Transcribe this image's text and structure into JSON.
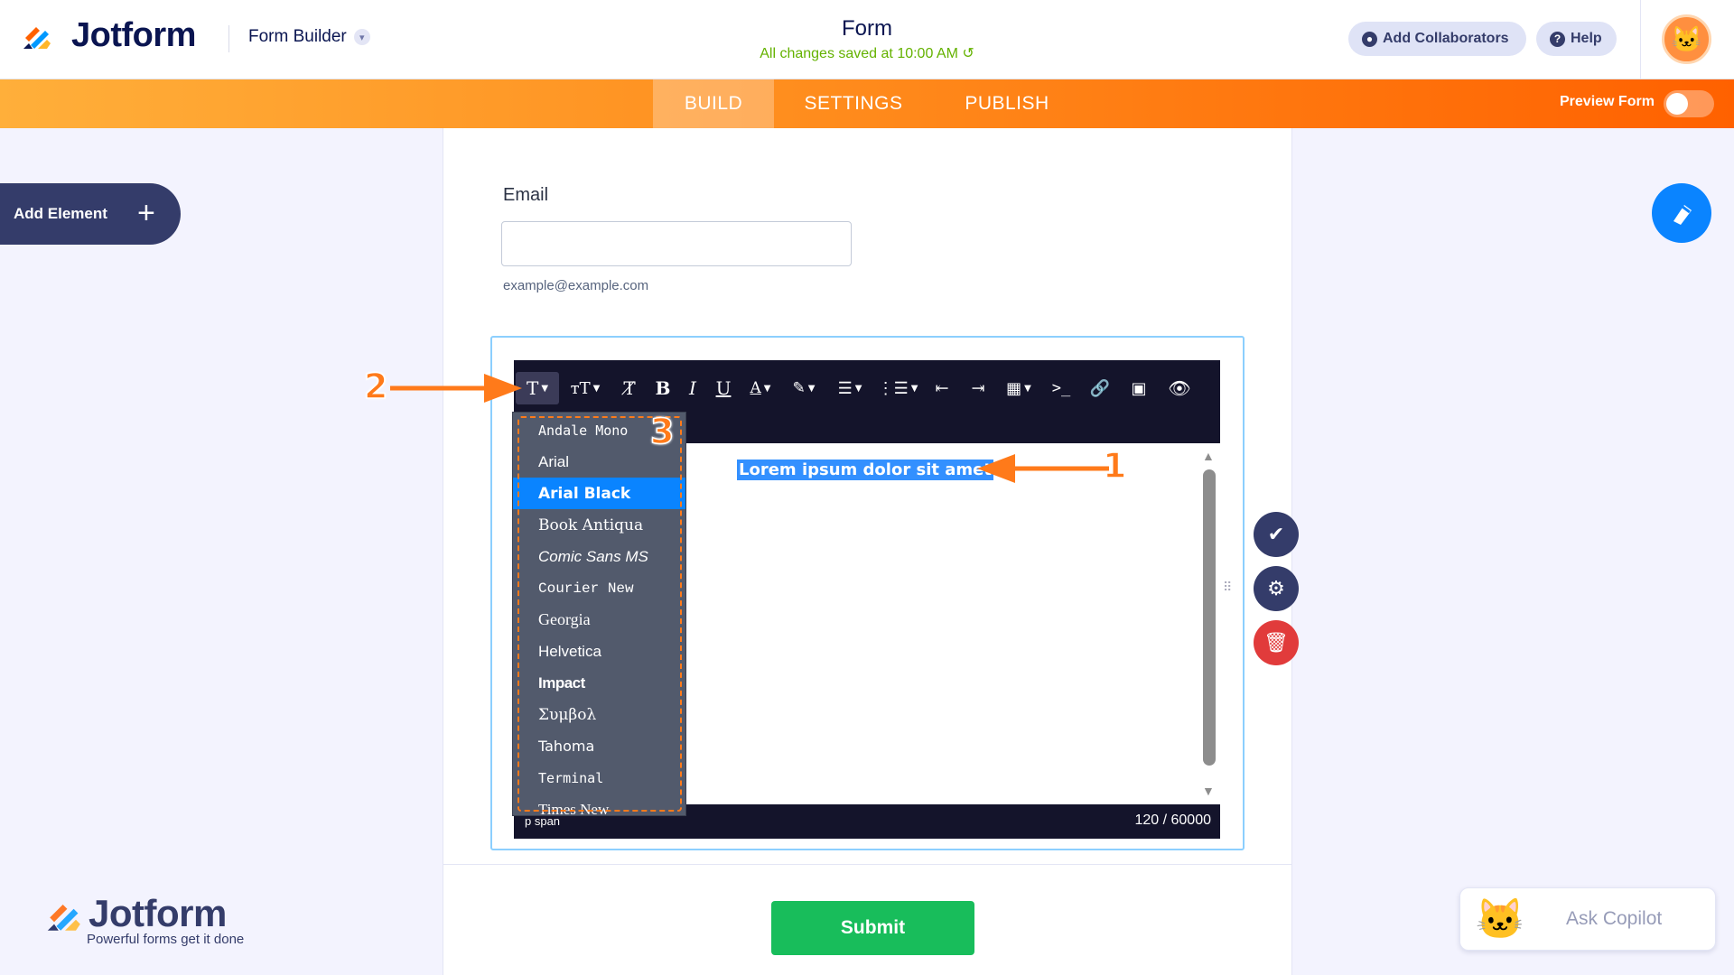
{
  "header": {
    "logo_text": "Jotform",
    "builder_label": "Form Builder",
    "form_title": "Form",
    "save_status": "All changes saved at 10:00 AM",
    "collaborators_label": "Add Collaborators",
    "help_label": "Help"
  },
  "nav": {
    "tabs": [
      {
        "label": "BUILD",
        "active": true
      },
      {
        "label": "SETTINGS",
        "active": false
      },
      {
        "label": "PUBLISH",
        "active": false
      }
    ],
    "preview_label": "Preview Form",
    "preview_on": false
  },
  "sidebar": {
    "add_element_label": "Add Element"
  },
  "form": {
    "email_label": "Email",
    "email_value": "",
    "email_sublabel": "example@example.com",
    "editor": {
      "selected_text": "Lorem ipsum dolor sit amet",
      "path": "p  span",
      "char_count": "120 / 60000",
      "font_menu": {
        "items": [
          "Andale Mono",
          "Arial",
          "Arial Black",
          "Book Antiqua",
          "Comic Sans MS",
          "Courier New",
          "Georgia",
          "Helvetica",
          "Impact",
          "Συμβολ",
          "Tahoma",
          "Terminal",
          "Times New"
        ],
        "selected": "Arial Black"
      }
    },
    "submit_label": "Submit"
  },
  "annotations": {
    "one": "1",
    "two": "2",
    "three": "3"
  },
  "branding": {
    "watermark_text": "Jotform",
    "watermark_tagline": "Powerful forms get it done"
  },
  "copilot": {
    "label": "Ask Copilot"
  },
  "colors": {
    "accent_orange": "#ff7a1a",
    "selection_blue": "#3390ff",
    "submit_green": "#18bd5b",
    "navy": "#0a1551"
  }
}
